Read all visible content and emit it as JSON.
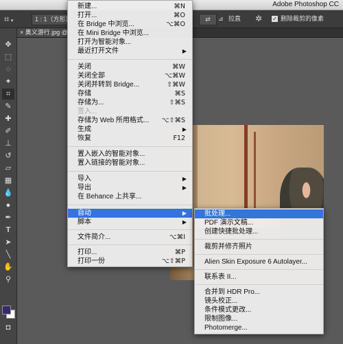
{
  "app_title": "Adobe Photoshop CC",
  "options_bar": {
    "ratio_value": "1 : 1（方形）",
    "straighten_label": "拉直",
    "delete_cropped_label": "删除裁剪的像素"
  },
  "document_tab": {
    "close_glyph": "×",
    "title": "奥义游行.jpg @"
  },
  "file_menu": {
    "items": [
      {
        "label": "新建...",
        "shortcut": "⌘N"
      },
      {
        "label": "打开...",
        "shortcut": "⌘O"
      },
      {
        "label": "在 Bridge 中浏览...",
        "shortcut": "⌥⌘O"
      },
      {
        "label": "在 Mini Bridge 中浏览...",
        "shortcut": ""
      },
      {
        "label": "打开为智能对象...",
        "shortcut": ""
      },
      {
        "label": "最近打开文件",
        "shortcut": "▶"
      },
      {
        "label": "关闭",
        "shortcut": "⌘W"
      },
      {
        "label": "关闭全部",
        "shortcut": "⌥⌘W"
      },
      {
        "label": "关闭并转到 Bridge...",
        "shortcut": "⇧⌘W"
      },
      {
        "label": "存储",
        "shortcut": "⌘S"
      },
      {
        "label": "存储为...",
        "shortcut": "⇧⌘S"
      },
      {
        "label": "签入...",
        "shortcut": ""
      },
      {
        "label": "存储为 Web 所用格式...",
        "shortcut": "⌥⇧⌘S"
      },
      {
        "label": "生成",
        "shortcut": "▶"
      },
      {
        "label": "恢复",
        "shortcut": "F12"
      },
      {
        "label": "置入嵌入的智能对象...",
        "shortcut": ""
      },
      {
        "label": "置入链接的智能对象...",
        "shortcut": ""
      },
      {
        "label": "导入",
        "shortcut": "▶"
      },
      {
        "label": "导出",
        "shortcut": "▶"
      },
      {
        "label": "在 Behance 上共享...",
        "shortcut": ""
      },
      {
        "label": "自动",
        "shortcut": "▶"
      },
      {
        "label": "脚本",
        "shortcut": "▶"
      },
      {
        "label": "文件简介...",
        "shortcut": "⌥⌘I"
      },
      {
        "label": "打印...",
        "shortcut": "⌘P"
      },
      {
        "label": "打印一份",
        "shortcut": "⌥⇧⌘P"
      }
    ]
  },
  "automate_submenu": {
    "items": [
      {
        "label": "批处理..."
      },
      {
        "label": "PDF 演示文稿..."
      },
      {
        "label": "创建快捷批处理..."
      },
      {
        "label": "裁剪并修齐照片"
      },
      {
        "label": "Alien Skin Exposure 6 Autolayer..."
      },
      {
        "label": "联系表 II..."
      },
      {
        "label": "合并到 HDR Pro..."
      },
      {
        "label": "镜头校正..."
      },
      {
        "label": "条件模式更改..."
      },
      {
        "label": "限制图像..."
      },
      {
        "label": "Photomerge..."
      }
    ]
  },
  "colors": {
    "accent": "#3574d8",
    "foreground_swatch": "#3a2a6a",
    "background_swatch": "#ffffff"
  }
}
